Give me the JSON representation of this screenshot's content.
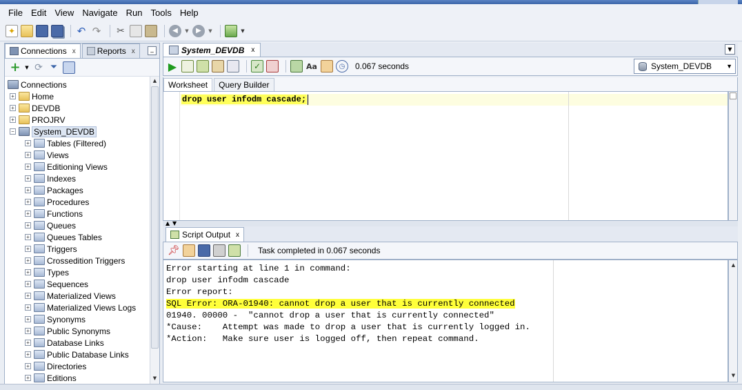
{
  "menu": [
    "File",
    "Edit",
    "View",
    "Navigate",
    "Run",
    "Tools",
    "Help"
  ],
  "left_panel": {
    "tabs": [
      {
        "label": "Connections",
        "close": "x"
      },
      {
        "label": "Reports",
        "close": "x"
      }
    ],
    "tree": {
      "root": "Connections",
      "top_nodes": [
        "Home",
        "DEVDB",
        "PROJRV",
        "System_DEVDB"
      ],
      "children": [
        "Tables (Filtered)",
        "Views",
        "Editioning Views",
        "Indexes",
        "Packages",
        "Procedures",
        "Functions",
        "Queues",
        "Queues Tables",
        "Triggers",
        "Crossedition Triggers",
        "Types",
        "Sequences",
        "Materialized Views",
        "Materialized Views Logs",
        "Synonyms",
        "Public Synonyms",
        "Database Links",
        "Public Database Links",
        "Directories",
        "Editions"
      ]
    }
  },
  "editor": {
    "tab_label": "System_DEVDB",
    "tab_close": "x",
    "elapsed": "0.067 seconds",
    "connection": "System_DEVDB",
    "subtabs": [
      "Worksheet",
      "Query Builder"
    ],
    "code": "drop user infodm cascade;"
  },
  "output": {
    "tab_label": "Script Output",
    "tab_close": "x",
    "status": "Task completed in 0.067 seconds",
    "lines": [
      "Error starting at line 1 in command:",
      "drop user infodm cascade",
      "Error report:",
      "SQL Error: ORA-01940: cannot drop a user that is currently connected",
      "01940. 00000 -  \"cannot drop a user that is currently connected\"",
      "*Cause:    Attempt was made to drop a user that is currently logged in.",
      "*Action:   Make sure user is logged off, then repeat command."
    ]
  },
  "colors": {
    "highlight": "#ffff3a",
    "panel_border": "#9fb0c8",
    "titlebar": "#3a64a8"
  },
  "icons": {
    "toolbar": [
      "new-icon",
      "open-icon",
      "save-icon",
      "save-all-icon",
      "undo-icon",
      "redo-icon",
      "cut-icon",
      "copy-icon",
      "paste-icon",
      "back-icon",
      "forward-icon",
      "sql-run-icon"
    ],
    "editor_toolbar": [
      "run-statement-icon",
      "run-script-icon",
      "autotrace-icon",
      "explain-plan-icon",
      "sql-tuning-icon",
      "commit-icon",
      "rollback-icon",
      "unshared-sql-icon",
      "format-icon",
      "clear-icon",
      "history-icon"
    ],
    "output_toolbar": [
      "pin-icon",
      "clear-output-icon",
      "save-output-icon",
      "print-icon",
      "export-icon"
    ]
  }
}
